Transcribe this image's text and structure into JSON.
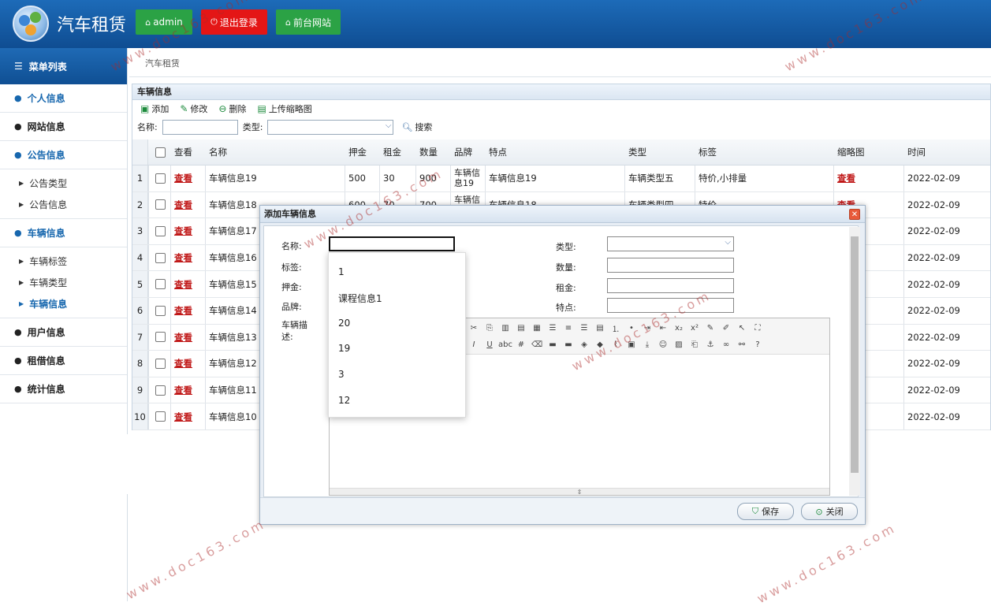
{
  "header": {
    "app_title": "汽车租赁",
    "admin_btn": "admin",
    "logout_btn": "退出登录",
    "front_btn": "前台网站",
    "colors": {
      "bar": "#1565b0",
      "green": "#2ba245",
      "red": "#e41616"
    }
  },
  "sidebar": {
    "menu_title": "菜单列表",
    "groups": [
      {
        "label": "个人信息",
        "active": true
      },
      {
        "label": "网站信息"
      },
      {
        "label": "公告信息",
        "active": true,
        "children": [
          "公告类型",
          "公告信息"
        ]
      },
      {
        "label": "车辆信息",
        "active": true,
        "children": [
          "车辆标签",
          "车辆类型",
          "车辆信息"
        ]
      },
      {
        "label": "用户信息"
      },
      {
        "label": "租借信息"
      },
      {
        "label": "统计信息"
      }
    ]
  },
  "breadcrumb": "汽车租赁",
  "panel": {
    "title": "车辆信息",
    "toolbar": {
      "add": "添加",
      "edit": "修改",
      "delete": "删除",
      "upload": "上传缩略图"
    },
    "search": {
      "name_label": "名称:",
      "type_label": "类型:",
      "search_btn": "搜索"
    },
    "columns": [
      "查看",
      "名称",
      "押金",
      "租金",
      "数量",
      "品牌",
      "特点",
      "类型",
      "标签",
      "缩略图",
      "时间"
    ],
    "rows": [
      {
        "n": "1",
        "view": "查看",
        "name": "车辆信息19",
        "deposit": "500",
        "rent": "30",
        "qty": "900",
        "brand": "车辆信息19",
        "feature": "车辆信息19",
        "type": "车辆类型五",
        "tag": "特价,小排量",
        "thumb": "查看",
        "date": "2022-02-09"
      },
      {
        "n": "2",
        "view": "查看",
        "name": "车辆信息18",
        "deposit": "600",
        "rent": "70",
        "qty": "700",
        "brand": "车辆信息18",
        "feature": "车辆信息18",
        "type": "车辆类型四",
        "tag": "特价",
        "thumb": "查看",
        "date": "2022-02-09"
      },
      {
        "n": "3",
        "view": "查看",
        "name": "车辆信息17",
        "date": "2022-02-09"
      },
      {
        "n": "4",
        "view": "查看",
        "name": "车辆信息16",
        "date": "2022-02-09"
      },
      {
        "n": "5",
        "view": "查看",
        "name": "车辆信息15",
        "date": "2022-02-09"
      },
      {
        "n": "6",
        "view": "查看",
        "name": "车辆信息14",
        "date": "2022-02-09"
      },
      {
        "n": "7",
        "view": "查看",
        "name": "车辆信息13",
        "date": "2022-02-09"
      },
      {
        "n": "8",
        "view": "查看",
        "name": "车辆信息12",
        "date": "2022-02-09"
      },
      {
        "n": "9",
        "view": "查看",
        "name": "车辆信息11",
        "date": "2022-02-09"
      },
      {
        "n": "10",
        "view": "查看",
        "name": "车辆信息10",
        "date": "2022-02-09"
      }
    ]
  },
  "dialog": {
    "title": "添加车辆信息",
    "labels": {
      "name": "名称:",
      "tag": "标签:",
      "deposit": "押金:",
      "brand": "品牌:",
      "desc": "车辆描述:",
      "type": "类型:",
      "qty": "数量:",
      "rent": "租金:",
      "feature": "特点:"
    },
    "tag_options": [
      "1",
      "课程信息1",
      "20",
      "19",
      "3",
      "12"
    ],
    "save_btn": "保存",
    "close_btn": "关闭"
  },
  "watermark": "www.doc163.com"
}
